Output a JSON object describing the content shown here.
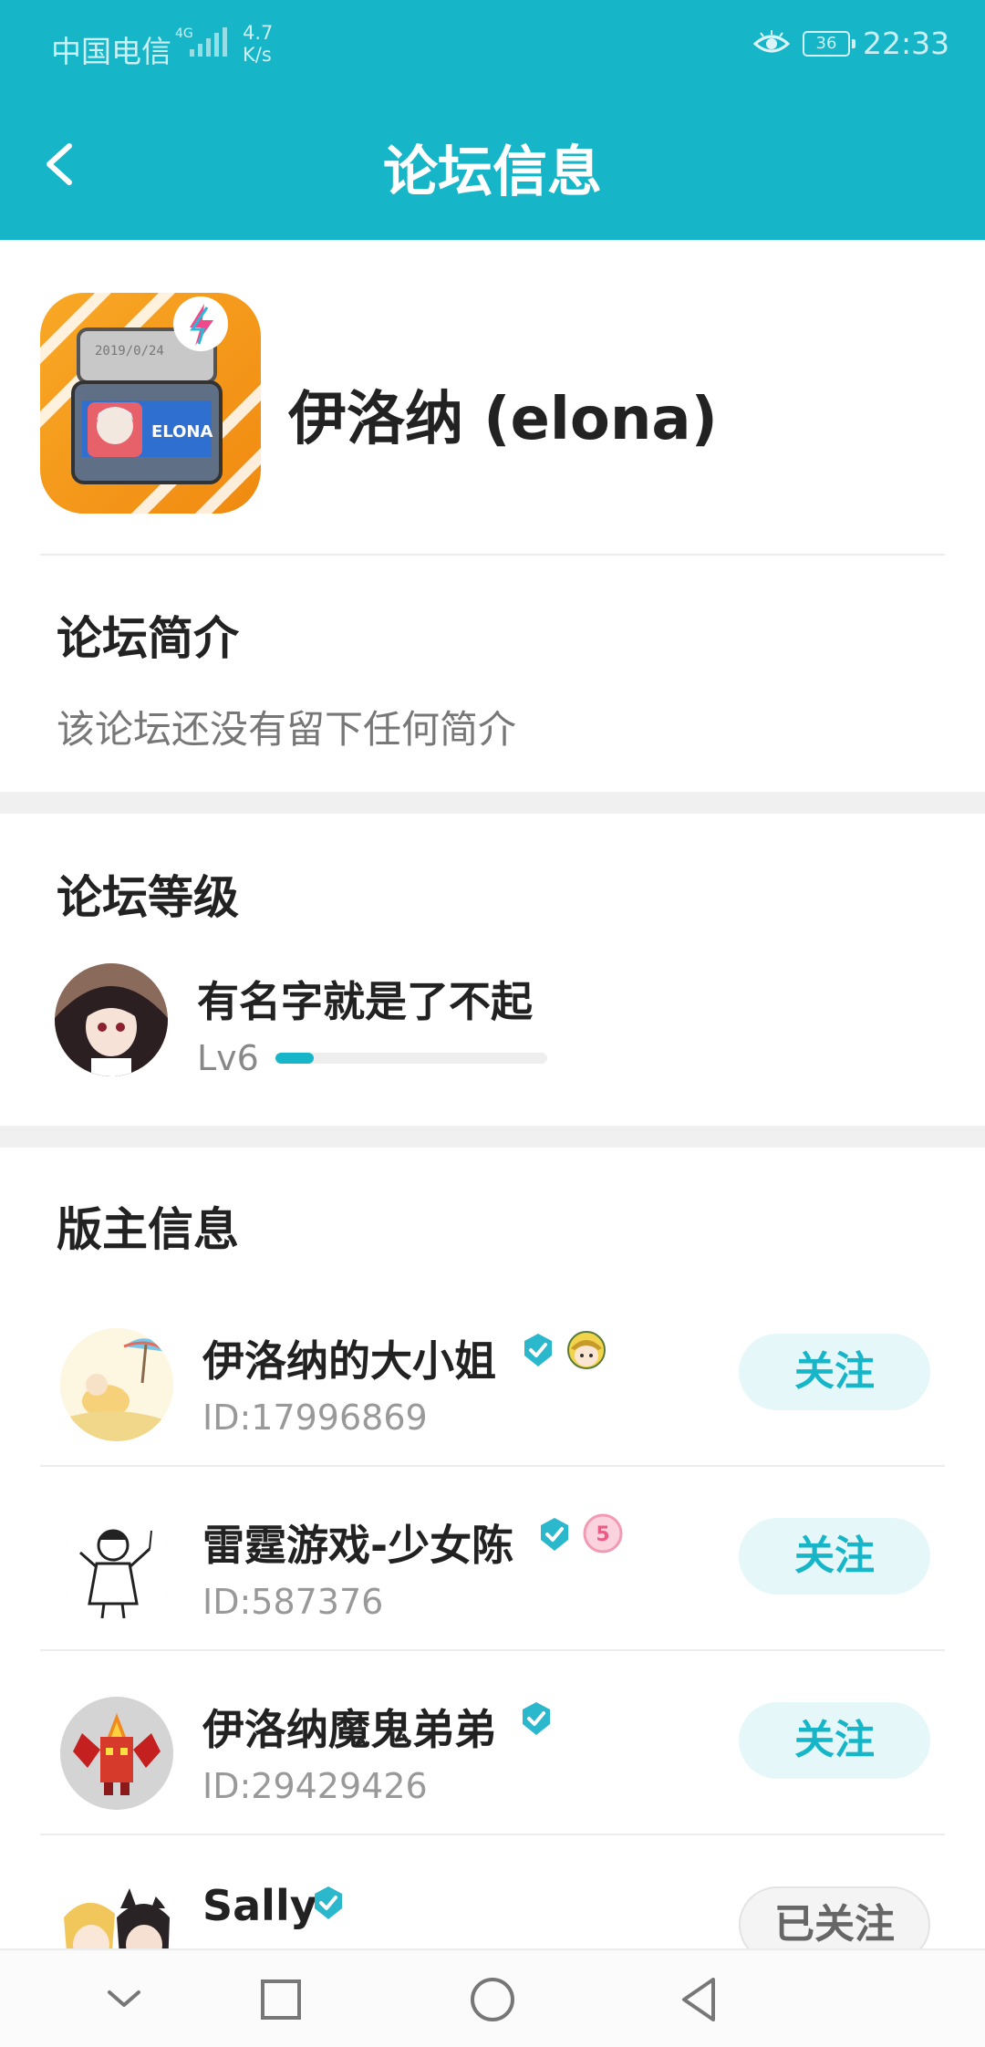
{
  "status_bar": {
    "carrier": "中国电信",
    "network": "4G",
    "speed_value": "4.7",
    "speed_unit": "K/s",
    "battery": "36",
    "time": "22:33",
    "icons": [
      "signal-icon",
      "eye-icon",
      "battery-icon"
    ]
  },
  "header": {
    "title": "论坛信息",
    "back_icon": "chevron-left-icon"
  },
  "forum": {
    "name": "伊洛纳 (elona)",
    "icon_label": "ELONA",
    "icon_date": "2019/0/24"
  },
  "intro": {
    "title": "论坛简介",
    "text": "该论坛还没有留下任何简介"
  },
  "level": {
    "title": "论坛等级",
    "name": "有名字就是了不起",
    "level_label": "Lv6",
    "progress_fraction": 0.14
  },
  "moderators": {
    "title": "版主信息",
    "items": [
      {
        "name": "伊洛纳的大小姐",
        "id": "ID:17996869",
        "follow_label": "关注",
        "followed": false,
        "verified": true,
        "extra_badge": "girl-face-icon"
      },
      {
        "name": "雷霆游戏-少女陈",
        "id": "ID:587376",
        "follow_label": "关注",
        "followed": false,
        "verified": true,
        "extra_badge": "pink-number-badge-icon",
        "extra_badge_text": "5"
      },
      {
        "name": "伊洛纳魔鬼弟弟",
        "id": "ID:29429426",
        "follow_label": "关注",
        "followed": false,
        "verified": true
      },
      {
        "name": "Sally",
        "id": "",
        "follow_label": "已关注",
        "followed": true,
        "verified": true
      }
    ]
  },
  "colors": {
    "accent": "#16b6c8",
    "follow_bg": "#e6f7f9",
    "followed_bg": "#f4f4f4"
  },
  "nav_bar": {
    "icons": [
      "chevron-down-icon",
      "square-icon",
      "circle-icon",
      "triangle-back-icon"
    ]
  }
}
